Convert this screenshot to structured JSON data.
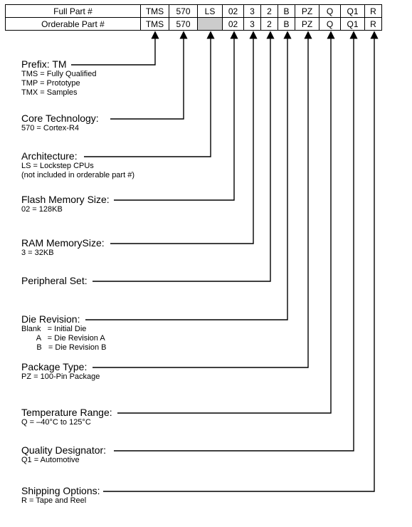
{
  "rows": {
    "full_label": "Full Part #",
    "orderable_label": "Orderable Part #",
    "full": {
      "tms": "TMS",
      "570": "570",
      "ls": "LS",
      "02": "02",
      "3": "3",
      "2": "2",
      "b": "B",
      "pz": "PZ",
      "q": "Q",
      "q1": "Q1",
      "r": "R"
    },
    "orderable": {
      "tms": "TMS",
      "570": "570",
      "ls": "",
      "02": "02",
      "3": "3",
      "2": "2",
      "b": "B",
      "pz": "PZ",
      "q": "Q",
      "q1": "Q1",
      "r": "R"
    }
  },
  "sections": {
    "prefix": {
      "title": "Prefix: TM",
      "l1": "TMS = Fully Qualified",
      "l2": "TMP = Prototype",
      "l3": "TMX = Samples"
    },
    "core": {
      "title": "Core Technology:",
      "l1": "570 = Cortex-R4"
    },
    "arch": {
      "title": "Architecture:",
      "l1": "LS = Lockstep CPUs",
      "l2": "(not included in orderable part #)"
    },
    "flash": {
      "title": "Flash Memory Size:",
      "l1": "02 = 128KB"
    },
    "ram": {
      "title": "RAM MemorySize:",
      "l1": "3 = 32KB"
    },
    "periph": {
      "title": "Peripheral Set:"
    },
    "die": {
      "title": "Die Revision:",
      "l1": "Blank   = Initial Die",
      "l2": "       A   = Die Revision A",
      "l3": "       B   = Die Revision B"
    },
    "pkg": {
      "title": "Package Type:",
      "l1": "PZ = 100-Pin Package"
    },
    "temp": {
      "title": "Temperature Range:",
      "l1": "Q = –40°C to 125°C"
    },
    "qual": {
      "title": "Quality Designator:",
      "l1": "Q1 = Automotive"
    },
    "ship": {
      "title": "Shipping Options:",
      "l1": "R = Tape and Reel"
    }
  }
}
